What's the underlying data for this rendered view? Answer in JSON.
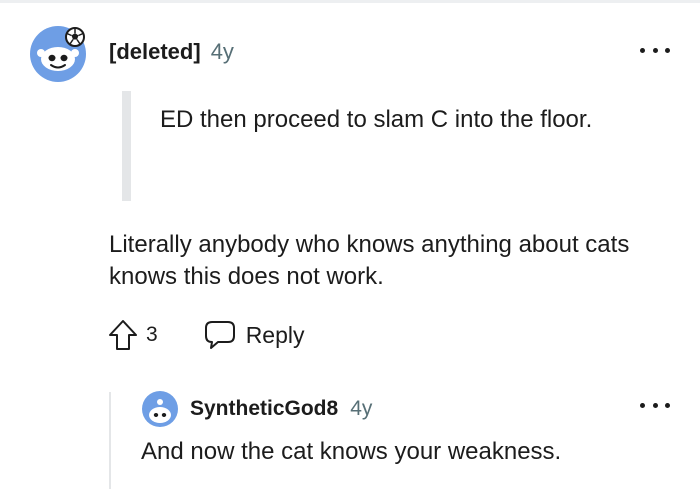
{
  "comment": {
    "author": "[deleted]",
    "age": "4y",
    "avatar_icon": "snoo-avatar-with-soccer-ball-icon",
    "quote": "ED then proceed to slam C into the floor.",
    "body": "Literally anybody who knows anything about cats knows this does not work.",
    "vote_count": "3",
    "upvote_icon": "upvote-arrow-icon",
    "reply_label": "Reply",
    "reply_icon": "speech-bubble-icon",
    "more_icon": "more-options-icon"
  },
  "reply": {
    "author": "SyntheticGod8",
    "age": "4y",
    "avatar_icon": "snoo-avatar-icon",
    "body": "And now the cat knows your weakness.",
    "more_icon": "more-options-icon"
  },
  "colors": {
    "avatar_blue": "#6e9ee5",
    "text": "#1c1c1c",
    "meta": "#576f76",
    "quote_bar": "#e4e6e8"
  }
}
